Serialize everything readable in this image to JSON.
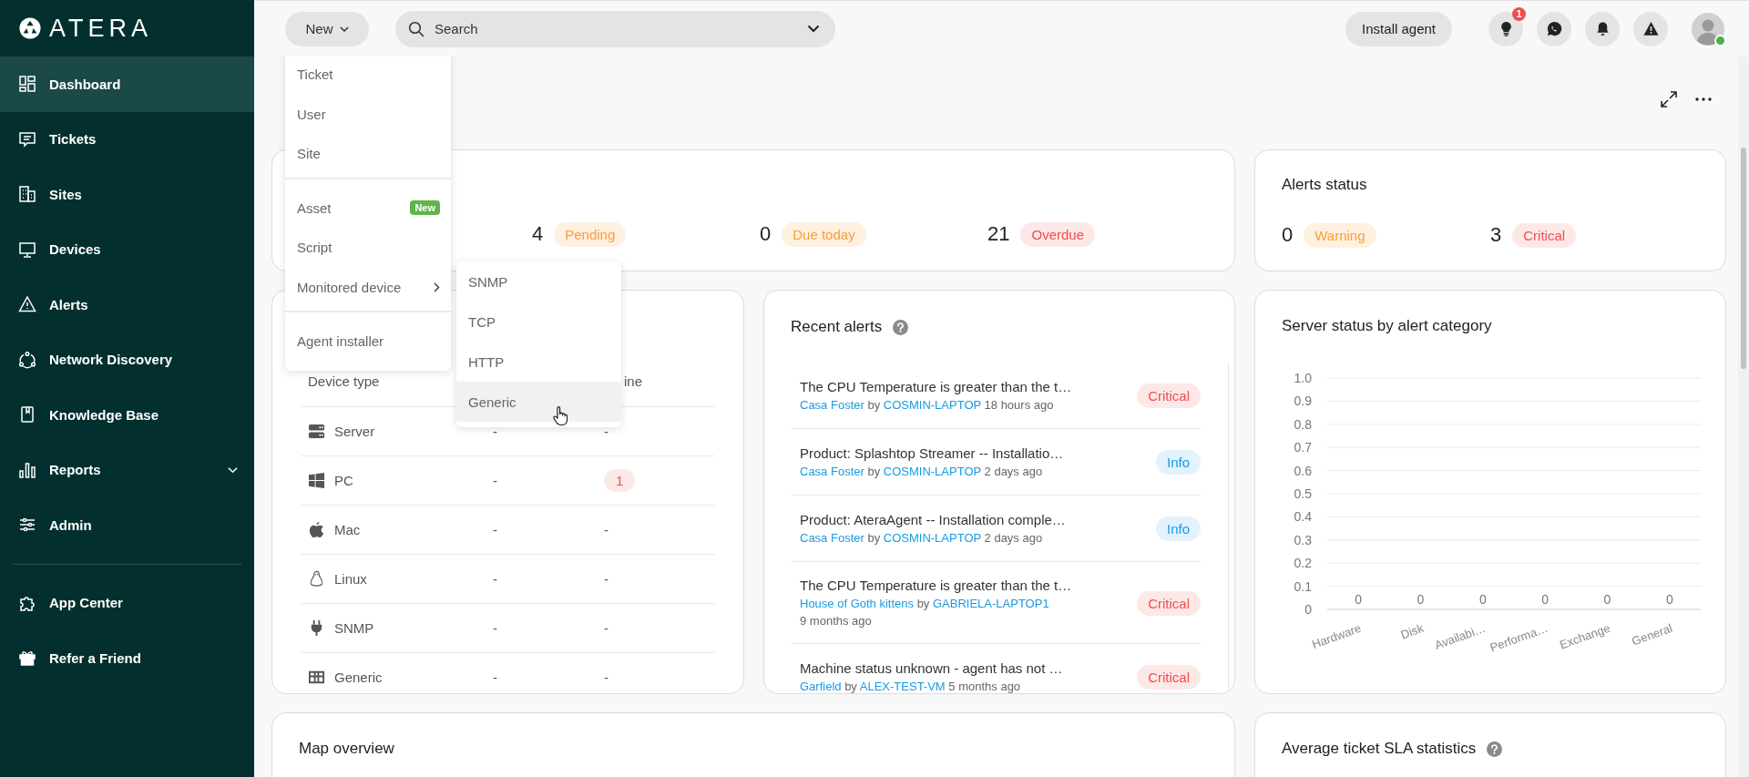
{
  "sidebar": {
    "logo": "ATERA",
    "items": [
      {
        "label": "Dashboard",
        "kind": "dashboard",
        "selected": true
      },
      {
        "label": "Tickets",
        "kind": "tickets",
        "selected": false
      },
      {
        "label": "Sites",
        "kind": "sites",
        "selected": false
      },
      {
        "label": "Devices",
        "kind": "devices",
        "selected": false
      },
      {
        "label": "Alerts",
        "kind": "alerts",
        "selected": false
      },
      {
        "label": "Network Discovery",
        "kind": "network",
        "selected": false
      },
      {
        "label": "Knowledge Base",
        "kind": "knowledge",
        "selected": false
      },
      {
        "label": "Reports",
        "kind": "reports",
        "selected": false,
        "has_submenu": true
      },
      {
        "label": "Admin",
        "kind": "admin",
        "selected": false
      }
    ],
    "bottom_items": [
      {
        "label": "App Center",
        "kind": "apps",
        "selected": false
      },
      {
        "label": "Refer a Friend",
        "kind": "gift",
        "selected": false
      }
    ]
  },
  "topbar": {
    "new_button": "New",
    "search": {
      "placeholder": "Search"
    },
    "install_button": "Install agent",
    "icons": [
      {
        "kind": "lightbulb",
        "badge": "1"
      },
      {
        "kind": "chat"
      },
      {
        "kind": "bell"
      },
      {
        "kind": "warning"
      }
    ],
    "avatar": {
      "online": true
    }
  },
  "new_menu": {
    "groups": [
      [
        {
          "label": "Ticket"
        },
        {
          "label": "User"
        },
        {
          "label": "Site"
        }
      ],
      [
        {
          "label": "Asset",
          "badge": "New"
        },
        {
          "label": "Script"
        },
        {
          "label": "Monitored device",
          "has_submenu": true
        }
      ],
      [
        {
          "label": "Agent installer"
        }
      ]
    ],
    "submenu": [
      {
        "label": "SNMP",
        "selected": false
      },
      {
        "label": "TCP",
        "selected": false
      },
      {
        "label": "HTTP",
        "selected": false
      },
      {
        "label": "Generic",
        "selected": true
      }
    ]
  },
  "tickets_card": {
    "stats": [
      {
        "count": "4",
        "label": "Pending",
        "kind": "warning"
      },
      {
        "count": "0",
        "label": "Due today",
        "kind": "warning"
      },
      {
        "count": "21",
        "label": "Overdue",
        "kind": "critical"
      }
    ]
  },
  "alerts_status": {
    "title": "Alerts status",
    "stats": [
      {
        "count": "0",
        "label": "Warning",
        "kind": "warning"
      },
      {
        "count": "3",
        "label": "Critical",
        "kind": "critical"
      }
    ]
  },
  "devices_card": {
    "columns": {
      "device_type": "Device type",
      "column_3": "ine"
    },
    "rows": [
      {
        "kind": "server",
        "name": "Server",
        "column_2": "-",
        "column_3": {
          "kind": "text",
          "text": "-"
        }
      },
      {
        "kind": "windows",
        "name": "PC",
        "column_2": "-",
        "column_3": {
          "kind": "badge",
          "text": "1"
        }
      },
      {
        "kind": "apple",
        "name": "Mac",
        "column_2": "-",
        "column_3": {
          "kind": "text",
          "text": "-"
        }
      },
      {
        "kind": "linux",
        "name": "Linux",
        "column_2": "-",
        "column_3": {
          "kind": "text",
          "text": "-"
        }
      },
      {
        "kind": "plug",
        "name": "SNMP",
        "column_2": "-",
        "column_3": {
          "kind": "text",
          "text": "-"
        }
      },
      {
        "kind": "grid",
        "name": "Generic",
        "column_2": "-",
        "column_3": {
          "kind": "text",
          "text": "-"
        }
      }
    ]
  },
  "recent_alerts": {
    "title": "Recent alerts",
    "alerts": [
      {
        "title": "The CPU Temperature is greater than the t…",
        "site": "Casa Foster",
        "by": "by",
        "device": "COSMIN-LAPTOP",
        "time": "18 hours ago",
        "severity": "Critical",
        "kind": "critical"
      },
      {
        "title": "Product: Splashtop Streamer -- Installatio…",
        "site": "Casa Foster",
        "by": "by",
        "device": "COSMIN-LAPTOP",
        "time": "2 days ago",
        "severity": "Info",
        "kind": "info"
      },
      {
        "title": "Product: AteraAgent -- Installation comple…",
        "site": "Casa Foster",
        "by": "by",
        "device": "COSMIN-LAPTOP",
        "time": "2 days ago",
        "severity": "Info",
        "kind": "info"
      },
      {
        "title": "The CPU Temperature is greater than the t…",
        "site": "House of Goth kittens",
        "by": "by",
        "device": "GABRIELA-LAPTOP1",
        "time": "9 months ago",
        "severity": "Critical",
        "kind": "critical"
      },
      {
        "title": "Machine status unknown - agent has not …",
        "site": "Garfield",
        "by": "by",
        "device": "ALEX-TEST-VM",
        "time": "5 months ago",
        "severity": "Critical",
        "kind": "critical"
      }
    ]
  },
  "server_status": {
    "title": "Server status by alert category",
    "chart_data": {
      "type": "bar",
      "categories": [
        "Hardware",
        "Disk",
        "Availabi…",
        "Performa…",
        "Exchange",
        "General"
      ],
      "values": [
        0,
        0,
        0,
        0,
        0,
        0
      ],
      "ylim": [
        0,
        1
      ],
      "yticks": [
        {
          "value": 0,
          "label": "0"
        },
        0.1,
        0.2,
        0.3,
        0.4,
        0.5,
        0.6,
        0.7,
        0.8,
        0.9,
        {
          "value": 1,
          "label": "1.0"
        }
      ],
      "grid": true,
      "value_labels": [
        "0",
        "0",
        "0",
        "0",
        "0",
        "0"
      ]
    }
  },
  "map_overview": {
    "title": "Map overview"
  },
  "sla_stats": {
    "title": "Average ticket SLA statistics"
  }
}
